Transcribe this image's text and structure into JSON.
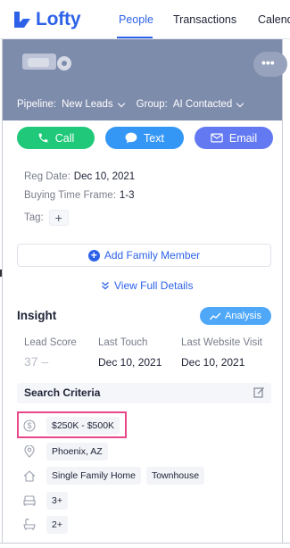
{
  "app": {
    "brand": "Lofty",
    "brand_color": "#2d62e8",
    "nav_tabs": [
      {
        "label": "People",
        "active": true
      },
      {
        "label": "Transactions",
        "active": false
      },
      {
        "label": "Calend",
        "active": false
      }
    ]
  },
  "lead_header": {
    "more_label": "•••",
    "pipeline_label": "Pipeline:",
    "pipeline_value": "New Leads",
    "group_label": "Group:",
    "group_value": "AI Contacted"
  },
  "actions": {
    "call": "Call",
    "text": "Text",
    "email": "Email"
  },
  "details": {
    "reg_date_label": "Reg Date:",
    "reg_date_value": "Dec 10, 2021",
    "buying_time_label": "Buying Time Frame:",
    "buying_time_value": "1-3",
    "tag_label": "Tag:",
    "tag_add": "+"
  },
  "add_family_label": "Add Family Member",
  "view_full_details": "View Full Details",
  "insight": {
    "title": "Insight",
    "analysis_label": "Analysis",
    "metrics": [
      {
        "label": "Lead Score",
        "value": "37 –"
      },
      {
        "label": "Last Touch",
        "value": "Dec 10, 2021"
      },
      {
        "label": "Last Website Visit",
        "value": "Dec 10, 2021"
      }
    ]
  },
  "search_criteria": {
    "title": "Search Criteria",
    "price": "$250K - $500K",
    "location": "Phoenix, AZ",
    "property_types": [
      "Single Family Home",
      "Townhouse"
    ],
    "beds": "3+",
    "baths": "2+"
  },
  "icons": {
    "call": "phone-icon",
    "text": "chat-bubble-icon",
    "email": "envelope-icon",
    "analysis": "trend-line-icon",
    "edit": "edit-icon",
    "price": "dollar-circle-icon",
    "location": "map-pin-icon",
    "property": "house-icon",
    "beds": "bed-icon",
    "baths": "bathtub-icon"
  },
  "colors": {
    "call_green": "#20c97a",
    "text_blue": "#3597f5",
    "email_indigo": "#6279f2",
    "header_slate": "#7e8cac",
    "highlight_pink": "#e8478a"
  }
}
